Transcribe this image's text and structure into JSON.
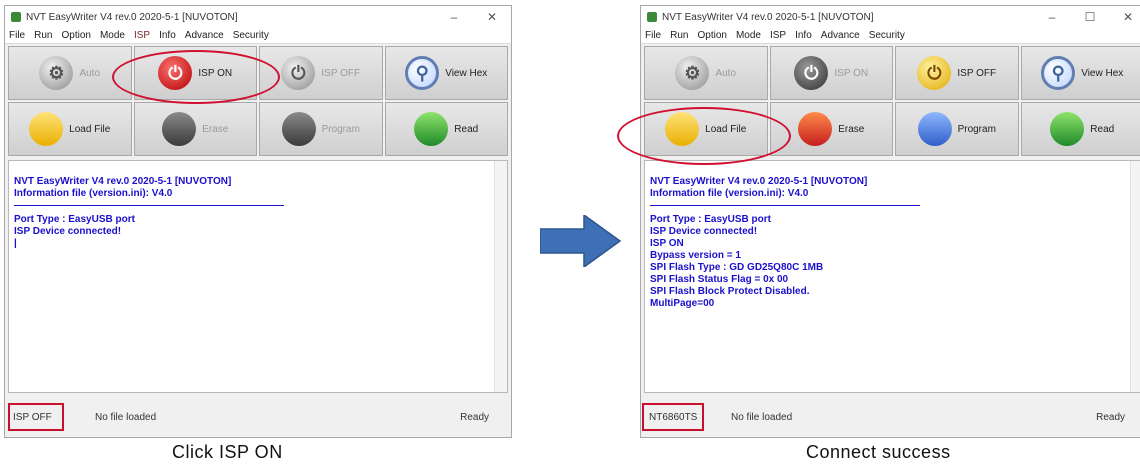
{
  "left_window": {
    "title": "NVT EasyWriter V4 rev.0 2020-5-1 [NUVOTON]",
    "menu": [
      "File",
      "Run",
      "Option",
      "Mode",
      "ISP",
      "Info",
      "Advance",
      "Security"
    ],
    "toolbar": {
      "auto": "Auto",
      "isp_on": "ISP ON",
      "isp_off": "ISP OFF",
      "view_hex": "View Hex",
      "load_file": "Load File",
      "erase": "Erase",
      "program": "Program",
      "read": "Read"
    },
    "log": {
      "header_1": "NVT EasyWriter V4 rev.0 2020-5-1 [NUVOTON]",
      "header_2": "Information file (version.ini): V4.0",
      "line_1": "Port Type : EasyUSB port",
      "line_2": "ISP Device connected!",
      "line_3": "|"
    },
    "status": {
      "state": "ISP OFF",
      "file": "No file loaded",
      "ready": "Ready"
    }
  },
  "right_window": {
    "title": "NVT EasyWriter V4 rev.0 2020-5-1 [NUVOTON]",
    "menu": [
      "File",
      "Run",
      "Option",
      "Mode",
      "ISP",
      "Info",
      "Advance",
      "Security"
    ],
    "toolbar": {
      "auto": "Auto",
      "isp_on": "ISP ON",
      "isp_off": "ISP OFF",
      "view_hex": "View Hex",
      "load_file": "Load File",
      "erase": "Erase",
      "program": "Program",
      "read": "Read"
    },
    "log": {
      "header_1": "NVT EasyWriter V4 rev.0 2020-5-1 [NUVOTON]",
      "header_2": "Information file (version.ini): V4.0",
      "line_1": "Port Type : EasyUSB port",
      "line_2": "ISP Device connected!",
      "line_3": "ISP ON",
      "line_4": "Bypass version = 1",
      "line_5": "SPI Flash Type : GD GD25Q80C 1MB",
      "line_6": "SPI Flash Status Flag = 0x 00",
      "line_7": "SPI Flash Block Protect Disabled.",
      "line_8": "MultiPage=00"
    },
    "status": {
      "state": "NT6860TS",
      "file": "No file loaded",
      "ready": "Ready"
    }
  },
  "captions": {
    "left": "Click ISP ON",
    "right": "Connect success"
  },
  "colors": {
    "log_text": "#1a10cc",
    "highlight": "#d01030",
    "arrow": "#3f6fb5"
  },
  "icons": {
    "auto": "auto-run-icon",
    "isp_on": "power-on-icon",
    "isp_off": "power-off-icon",
    "view_hex": "magnifier-icon",
    "load_file": "folder-icon",
    "erase": "chip-erase-icon",
    "program": "chip-program-icon",
    "read": "chip-read-icon"
  }
}
